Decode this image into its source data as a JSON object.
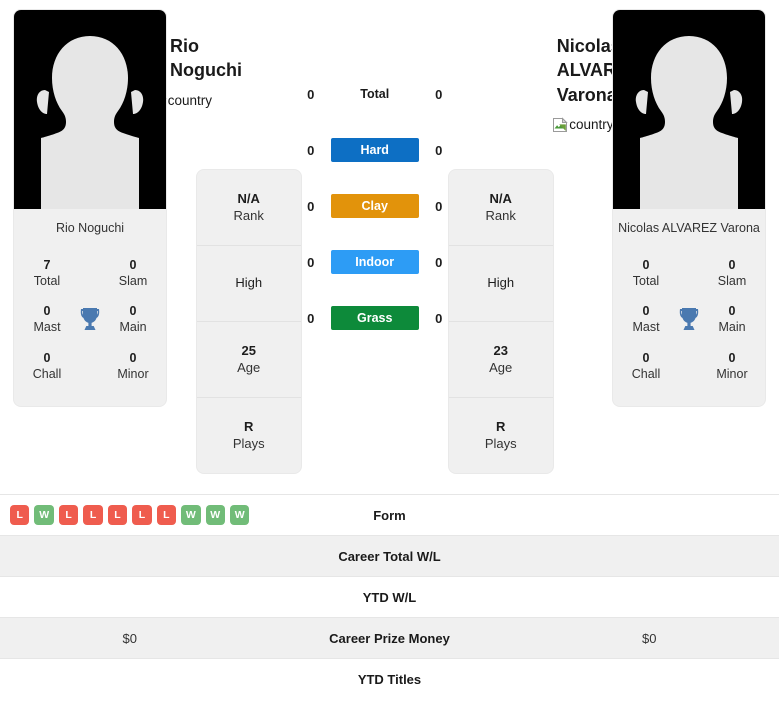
{
  "players": [
    {
      "name": "Rio Noguchi",
      "photo_caption": "Rio Noguchi",
      "country_alt": "country",
      "avatar_icon": "person-silhouette-placeholder",
      "titles": {
        "trophy_icon": "trophy-icon",
        "cells": [
          {
            "value": "7",
            "label": "Total"
          },
          {
            "value": "0",
            "label": "Slam"
          },
          {
            "value": "0",
            "label": "Mast"
          },
          {
            "value": "0",
            "label": "Main"
          },
          {
            "value": "0",
            "label": "Chall"
          },
          {
            "value": "0",
            "label": "Minor"
          }
        ]
      },
      "info": [
        {
          "value": "N/A",
          "label": "Rank",
          "bold": true
        },
        {
          "value": "High",
          "label": "",
          "bold": false
        },
        {
          "value": "25",
          "label": "Age",
          "bold": true
        },
        {
          "value": "R",
          "label": "Plays",
          "bold": true
        }
      ]
    },
    {
      "name": "Nicolas ALVAREZ Varona",
      "photo_caption": "Nicolas ALVAREZ Varona",
      "country_alt": "country",
      "avatar_icon": "person-silhouette-placeholder",
      "titles": {
        "trophy_icon": "trophy-icon",
        "cells": [
          {
            "value": "0",
            "label": "Total"
          },
          {
            "value": "0",
            "label": "Slam"
          },
          {
            "value": "0",
            "label": "Mast"
          },
          {
            "value": "0",
            "label": "Main"
          },
          {
            "value": "0",
            "label": "Chall"
          },
          {
            "value": "0",
            "label": "Minor"
          }
        ]
      },
      "info": [
        {
          "value": "N/A",
          "label": "Rank",
          "bold": true
        },
        {
          "value": "High",
          "label": "",
          "bold": false
        },
        {
          "value": "23",
          "label": "Age",
          "bold": true
        },
        {
          "value": "R",
          "label": "Plays",
          "bold": true
        }
      ]
    }
  ],
  "surfaces": [
    {
      "label": "Total",
      "left": "0",
      "right": "0",
      "color": "transparent",
      "plain": true
    },
    {
      "label": "Hard",
      "left": "0",
      "right": "0",
      "color": "#0d6fc4",
      "plain": false
    },
    {
      "label": "Clay",
      "left": "0",
      "right": "0",
      "color": "#e2930b",
      "plain": false
    },
    {
      "label": "Indoor",
      "left": "0",
      "right": "0",
      "color": "#2d9cf5",
      "plain": false
    },
    {
      "label": "Grass",
      "left": "0",
      "right": "0",
      "color": "#0d8a3a",
      "plain": false
    }
  ],
  "table_rows": [
    {
      "label": "Form",
      "alt": false,
      "left_form": [
        "L",
        "W",
        "L",
        "L",
        "L",
        "L",
        "L",
        "W",
        "W",
        "W"
      ],
      "left_text": "",
      "right_text": ""
    },
    {
      "label": "Career Total W/L",
      "alt": true,
      "left_text": "",
      "right_text": ""
    },
    {
      "label": "YTD W/L",
      "alt": false,
      "left_text": "",
      "right_text": ""
    },
    {
      "label": "Career Prize Money",
      "alt": true,
      "left_text": "$0",
      "right_text": "$0"
    },
    {
      "label": "YTD Titles",
      "alt": false,
      "left_text": "",
      "right_text": ""
    }
  ],
  "colors": {
    "win_badge": "#71bc78",
    "loss_badge": "#ef5c4e",
    "trophy": "#4a79b0",
    "card_bg": "#f0f0f0",
    "row_alt_bg": "#f0f0f0"
  }
}
